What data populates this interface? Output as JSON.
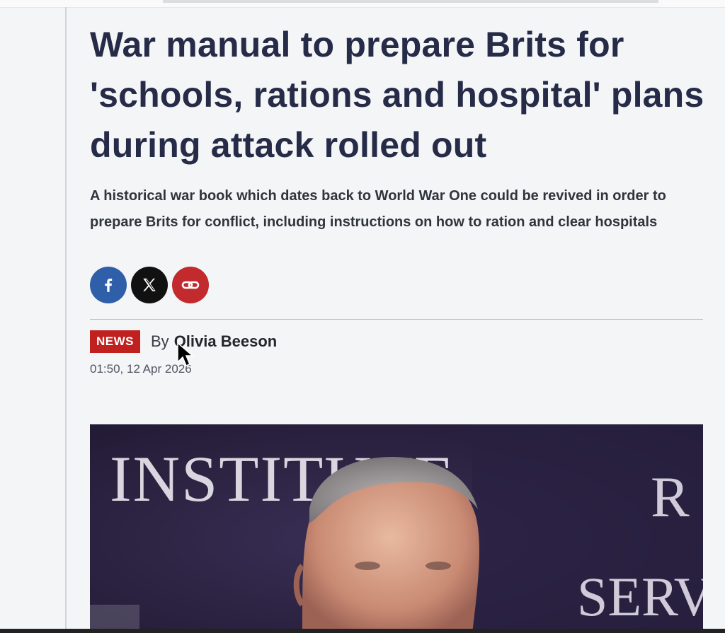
{
  "article": {
    "headline": "War manual to prepare Brits for 'schools, rations and hospital' plans during attack rolled out",
    "standfirst": "A historical war book which dates back to World War One could be revived in order to prepare Brits for conflict, including instructions on how to ration and clear hospitals",
    "share": [
      {
        "name": "facebook",
        "icon": "facebook-icon",
        "color": "#2f5fa8"
      },
      {
        "name": "x",
        "icon": "x-logo-icon",
        "color": "#111111"
      },
      {
        "name": "copy-link",
        "icon": "link-icon",
        "color": "#c22a2d"
      }
    ],
    "category_badge": "NEWS",
    "by_label": "By",
    "author": "Olivia Beeson",
    "timestamp": "01:50, 12 Apr 2026",
    "hero_image": {
      "sign_left": "INSTITUTE",
      "sign_right_top": "R",
      "sign_right_bottom": "SERV"
    }
  },
  "colors": {
    "headline": "#262b47",
    "badge": "#c0211f",
    "page_bg": "#f4f5f7"
  }
}
